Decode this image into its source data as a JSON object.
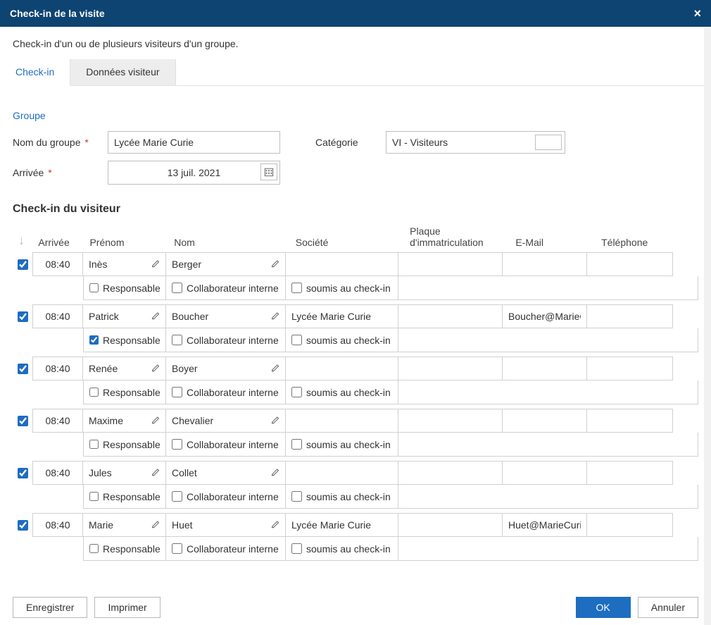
{
  "title": "Check-in de la visite",
  "subtitle": "Check-in d'un ou de plusieurs visiteurs d'un groupe.",
  "tabs": [
    {
      "label": "Check-in",
      "active": true
    },
    {
      "label": "Données visiteur",
      "active": false
    }
  ],
  "group_section": {
    "heading": "Groupe",
    "name_label": "Nom du groupe",
    "name_value": "Lycée Marie Curie",
    "category_label": "Catégorie",
    "category_value": "VI - Visiteurs",
    "arrival_label": "Arrivée",
    "arrival_value": "13 juil. 2021"
  },
  "visitor_section": {
    "heading": "Check-in du visiteur",
    "columns": {
      "arrival": "Arrivée",
      "firstname": "Prénom",
      "lastname": "Nom",
      "company": "Société",
      "plate": "Plaque d'immatriculation",
      "email": "E-Mail",
      "phone": "Téléphone"
    },
    "sub_labels": {
      "responsible": "Responsable",
      "internal": "Collaborateur interne",
      "subject": "soumis au check-in"
    },
    "rows": [
      {
        "checked": true,
        "arrival": "08:40",
        "firstname": "Inès",
        "lastname": "Berger",
        "company": "",
        "plate": "",
        "email": "",
        "phone": "",
        "responsible": false,
        "internal": false,
        "subject": false
      },
      {
        "checked": true,
        "arrival": "08:40",
        "firstname": "Patrick",
        "lastname": "Boucher",
        "company": "Lycée Marie Curie",
        "plate": "",
        "email": "Boucher@MarieC",
        "phone": "",
        "responsible": true,
        "internal": false,
        "subject": false
      },
      {
        "checked": true,
        "arrival": "08:40",
        "firstname": "Renée",
        "lastname": "Boyer",
        "company": "",
        "plate": "",
        "email": "",
        "phone": "",
        "responsible": false,
        "internal": false,
        "subject": false
      },
      {
        "checked": true,
        "arrival": "08:40",
        "firstname": "Maxime",
        "lastname": "Chevalier",
        "company": "",
        "plate": "",
        "email": "",
        "phone": "",
        "responsible": false,
        "internal": false,
        "subject": false
      },
      {
        "checked": true,
        "arrival": "08:40",
        "firstname": "Jules",
        "lastname": "Collet",
        "company": "",
        "plate": "",
        "email": "",
        "phone": "",
        "responsible": false,
        "internal": false,
        "subject": false
      },
      {
        "checked": true,
        "arrival": "08:40",
        "firstname": "Marie",
        "lastname": "Huet",
        "company": "Lycée Marie Curie",
        "plate": "",
        "email": "Huet@MarieCuri",
        "phone": "",
        "responsible": false,
        "internal": false,
        "subject": false
      }
    ]
  },
  "footer": {
    "save": "Enregistrer",
    "print": "Imprimer",
    "ok": "OK",
    "cancel": "Annuler"
  },
  "required_mark": "*"
}
